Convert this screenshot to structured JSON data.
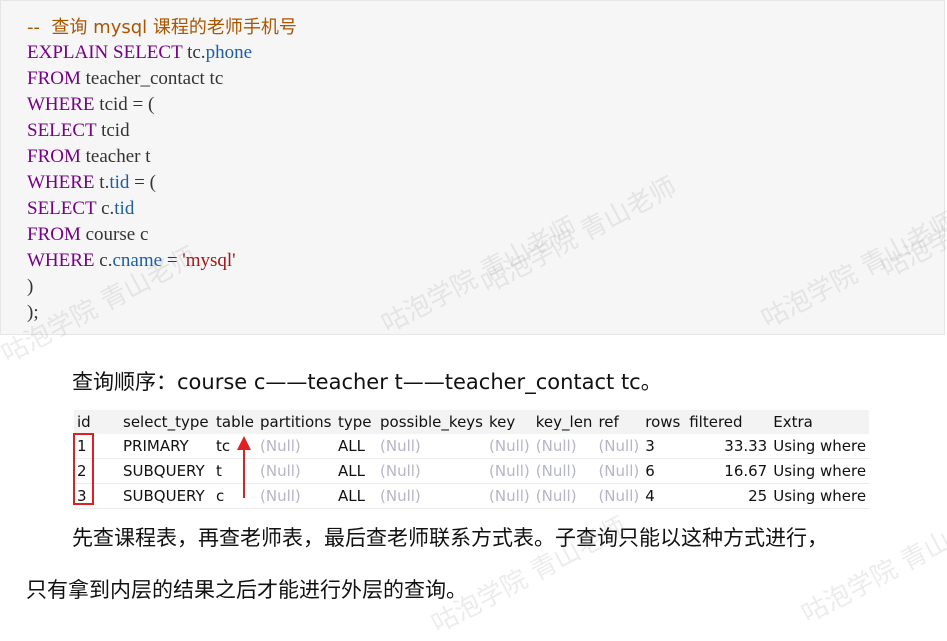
{
  "code": {
    "comment": "--  查询 mysql 课程的老师手机号",
    "lines": [
      [
        {
          "t": "kw",
          "v": "EXPLAIN SELECT "
        },
        {
          "t": "plain",
          "v": "tc."
        },
        {
          "t": "prop",
          "v": "phone"
        }
      ],
      [
        {
          "t": "kw",
          "v": "FROM "
        },
        {
          "t": "plain",
          "v": "teacher_contact tc"
        }
      ],
      [
        {
          "t": "kw",
          "v": "WHERE "
        },
        {
          "t": "plain",
          "v": "tcid = ("
        }
      ],
      [
        {
          "t": "kw",
          "v": "SELECT "
        },
        {
          "t": "plain",
          "v": "tcid"
        }
      ],
      [
        {
          "t": "kw",
          "v": "FROM "
        },
        {
          "t": "plain",
          "v": "teacher t"
        }
      ],
      [
        {
          "t": "kw",
          "v": "WHERE "
        },
        {
          "t": "plain",
          "v": "t."
        },
        {
          "t": "prop",
          "v": "tid"
        },
        {
          "t": "plain",
          "v": " = ("
        }
      ],
      [
        {
          "t": "kw",
          "v": "SELECT "
        },
        {
          "t": "plain",
          "v": "c."
        },
        {
          "t": "prop",
          "v": "tid"
        }
      ],
      [
        {
          "t": "kw",
          "v": "FROM "
        },
        {
          "t": "plain",
          "v": "course c"
        }
      ],
      [
        {
          "t": "kw",
          "v": "WHERE "
        },
        {
          "t": "plain",
          "v": "c."
        },
        {
          "t": "prop",
          "v": "cname"
        },
        {
          "t": "plain",
          "v": " = "
        },
        {
          "t": "str",
          "v": "'mysql'"
        }
      ],
      [
        {
          "t": "plain",
          "v": ")"
        }
      ],
      [
        {
          "t": "plain",
          "v": ");"
        }
      ]
    ]
  },
  "order_text": "查询顺序：course c——teacher t——teacher_contact tc。",
  "result": {
    "headers": [
      "id",
      "select_type",
      "table",
      "partitions",
      "type",
      "possible_keys",
      "key",
      "key_len",
      "ref",
      "rows",
      "filtered",
      "Extra"
    ],
    "rows": [
      [
        "1",
        "PRIMARY",
        "tc",
        "(Null)",
        "ALL",
        "(Null)",
        "(Null)",
        "(Null)",
        "(Null)",
        "3",
        "33.33",
        "Using where"
      ],
      [
        "2",
        "SUBQUERY",
        "t",
        "(Null)",
        "ALL",
        "(Null)",
        "(Null)",
        "(Null)",
        "(Null)",
        "6",
        "16.67",
        "Using where"
      ],
      [
        "3",
        "SUBQUERY",
        "c",
        "(Null)",
        "ALL",
        "(Null)",
        "(Null)",
        "(Null)",
        "(Null)",
        "4",
        "25",
        "Using where"
      ]
    ]
  },
  "explanation_1": "先查课程表，再查老师表，最后查老师联系方式表。子查询只能以这种方式进行，",
  "explanation_2": "只有拿到内层的结果之后才能进行外层的查询。",
  "watermark": "咕泡学院 青山老师",
  "colors": {
    "keyword": "#770088",
    "property": "#1b5ea8",
    "string": "#aa1111",
    "comment": "#aa5500",
    "annotation": "#e02020"
  }
}
